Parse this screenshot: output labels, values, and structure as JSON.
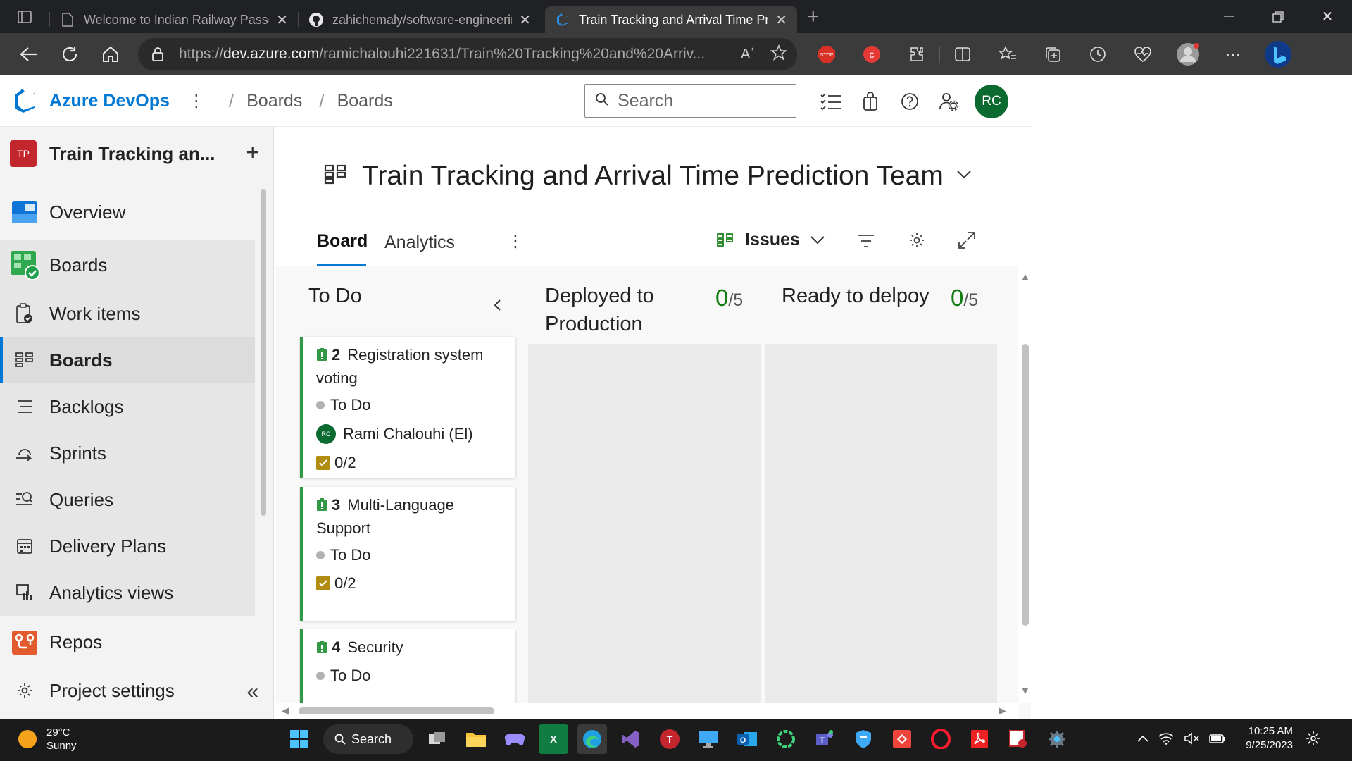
{
  "browser": {
    "tabs": [
      {
        "title": "Welcome to Indian Railway Passe",
        "icon": "document-icon",
        "active": false
      },
      {
        "title": "zahichemaly/software-engineerin",
        "icon": "github-icon",
        "active": false
      },
      {
        "title": "Train Tracking and Arrival Time Pr",
        "icon": "azure-devops-icon",
        "active": true
      }
    ],
    "url_prefix": "https://",
    "url_domain": "dev.azure.com",
    "url_path": "/ramichalouhi221631/Train%20Tracking%20and%20Arriv...",
    "read_aloud_label": "Aʾ"
  },
  "ado_header": {
    "brand": "Azure DevOps",
    "breadcrumbs": [
      "Boards",
      "Boards"
    ],
    "search_placeholder": "Search",
    "avatar_initials": "RC"
  },
  "leftnav": {
    "project_badge": "TP",
    "project_name": "Train Tracking an...",
    "items": [
      {
        "label": "Overview",
        "icon": "overview-icon"
      },
      {
        "label": "Boards",
        "icon": "boards-hub-icon"
      },
      {
        "label": "Work items",
        "icon": "work-items-icon"
      },
      {
        "label": "Boards",
        "icon": "boards-icon"
      },
      {
        "label": "Backlogs",
        "icon": "backlogs-icon"
      },
      {
        "label": "Sprints",
        "icon": "sprints-icon"
      },
      {
        "label": "Queries",
        "icon": "queries-icon"
      },
      {
        "label": "Delivery Plans",
        "icon": "delivery-plans-icon"
      },
      {
        "label": "Analytics views",
        "icon": "analytics-views-icon"
      },
      {
        "label": "Repos",
        "icon": "repos-icon"
      }
    ],
    "project_settings": "Project settings"
  },
  "main": {
    "team_title": "Train Tracking and Arrival Time Prediction Team",
    "tabs": [
      {
        "label": "Board",
        "active": true
      },
      {
        "label": "Analytics",
        "active": false
      }
    ],
    "backlog_level": "Issues",
    "columns": [
      {
        "title": "To Do",
        "count": "",
        "limit": ""
      },
      {
        "title": "Deployed to Production",
        "count": "0",
        "limit": "/5"
      },
      {
        "title": "Ready to delpoy",
        "count": "0",
        "limit": "/5"
      }
    ],
    "cards": [
      {
        "id": "2",
        "title": "Registration system voting",
        "state": "To Do",
        "assignee": "Rami Chalouhi (El)",
        "assignee_initials": "RC",
        "tasks": "0/2"
      },
      {
        "id": "3",
        "title": "Multi-Language Support",
        "state": "To Do",
        "assignee": "",
        "tasks": "0/2"
      },
      {
        "id": "4",
        "title": "Security",
        "state": "To Do",
        "assignee": "",
        "tasks": ""
      }
    ]
  },
  "taskbar": {
    "temperature": "29°C",
    "condition": "Sunny",
    "search_label": "Search",
    "time": "10:25 AM",
    "date": "9/25/2023"
  },
  "colors": {
    "accent": "#0078d4",
    "card_border": "#339947",
    "count_green": "#107c10",
    "avatar_green": "#0b6a2f",
    "project_badge_red": "#c4262e"
  }
}
